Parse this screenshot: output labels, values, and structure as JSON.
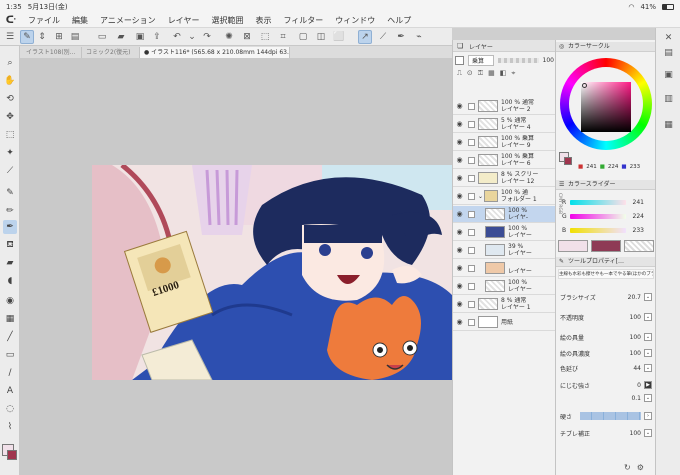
{
  "status": {
    "time": "1:35",
    "date": "5月13日(金)",
    "battery": "41%"
  },
  "menu": [
    "ファイル",
    "編集",
    "アニメーション",
    "レイヤー",
    "選択範囲",
    "表示",
    "フィルター",
    "ウィンドウ",
    "ヘルプ"
  ],
  "tabs": [
    "イラスト108(別…",
    "コミック2(復元)",
    "● イラスト116* (565.68 x 210.08mm 144dpi 63.5%)"
  ],
  "canvas": {
    "price_tag": "£1000"
  },
  "layer_panel": {
    "title": "レイヤー",
    "blend_mode": "乗算",
    "opacity": "100",
    "layers": [
      {
        "line1": "100 % 通常",
        "line2": "レイヤー 2"
      },
      {
        "line1": "5 % 通常",
        "line2": "レイヤー 4"
      },
      {
        "line1": "100 % 乗算",
        "line2": "レイヤー 9"
      },
      {
        "line1": "100 % 乗算",
        "line2": "レイヤー 6"
      },
      {
        "line1": "8 % スクリー",
        "line2": "レイヤー 12"
      },
      {
        "line1": "100 % 通",
        "line2": "フォルダー 1"
      },
      {
        "line1": "100 %",
        "line2": "レイヤ-"
      },
      {
        "line1": "100 %",
        "line2": "レイヤー"
      },
      {
        "line1": "39 %",
        "line2": "レイヤー"
      },
      {
        "line1": "",
        "line2": "レイヤー"
      },
      {
        "line1": "100 %",
        "line2": "レイヤー"
      },
      {
        "line1": "8 % 通常",
        "line2": "レイヤー 1"
      },
      {
        "line1": "",
        "line2": "用紙"
      }
    ]
  },
  "color_circle": {
    "title": "カラーサークル",
    "r": "241",
    "g": "224",
    "b": "233"
  },
  "color_slider": {
    "title": "カラースライダー",
    "r_label": "R",
    "g_label": "G",
    "b_label": "B",
    "r": "241",
    "g": "224",
    "b": "233",
    "cmy_tab": "CMY",
    "rgb_tab": "RGB"
  },
  "tool_property": {
    "title": "ツールプロパティ[…",
    "brush_desc": "主線も水彩も擦せやも一本でやる筆(ほかのブラシ",
    "props": [
      {
        "label": "ブラシサイズ",
        "value": "20.7"
      },
      {
        "label": "不透明度",
        "value": "100"
      },
      {
        "label": "絵の具量",
        "value": "100"
      },
      {
        "label": "絵の具濃度",
        "value": "100"
      },
      {
        "label": "色延び",
        "value": "44"
      },
      {
        "label": "にじむ強さ",
        "value": "0"
      },
      {
        "label": "",
        "value": "0.1"
      },
      {
        "label": "硬さ",
        "value": ""
      },
      {
        "label": "チブレ補正",
        "value": "100"
      }
    ]
  },
  "colors": {
    "main": "#f1e0e9",
    "sub": "#a0354e",
    "accent": "#3d7bd0"
  }
}
